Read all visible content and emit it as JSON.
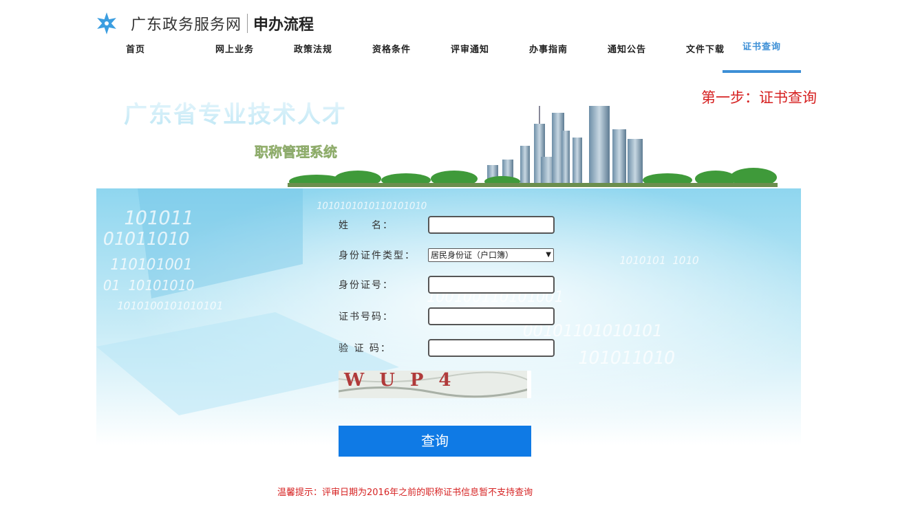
{
  "header": {
    "site_name": "广东政务服务网",
    "section_name": "申办流程"
  },
  "nav": {
    "items": [
      {
        "label": "首页",
        "active": false
      },
      {
        "label": "网上业务",
        "active": false
      },
      {
        "label": "政策法规",
        "active": false
      },
      {
        "label": "资格条件",
        "active": false
      },
      {
        "label": "评审通知",
        "active": false
      },
      {
        "label": "办事指南",
        "active": false
      },
      {
        "label": "通知公告",
        "active": false
      },
      {
        "label": "文件下载",
        "active": false
      },
      {
        "label": "证书查询",
        "active": true
      }
    ]
  },
  "step_title": "第一步：证书查询",
  "banner": {
    "title": "广东省专业技术人才",
    "subtitle": "职称管理系统"
  },
  "form": {
    "name_label": "姓　　名：",
    "name_value": "",
    "id_type_label": "身份证件类型：",
    "id_type_selected": "居民身份证（户口簿）",
    "id_number_label": "身份证号：",
    "id_number_value": "",
    "cert_number_label": "证书号码：",
    "cert_number_value": "",
    "captcha_label": "验 证 码：",
    "captcha_value": "",
    "captcha_image_text": "WUP4",
    "submit_label": "查询"
  },
  "tip": "温馨提示：评审日期为2016年之前的职称证书信息暂不支持查询",
  "colors": {
    "accent_blue": "#3d8fd6",
    "button_blue": "#0f7ae5",
    "warning_red": "#d62222"
  }
}
